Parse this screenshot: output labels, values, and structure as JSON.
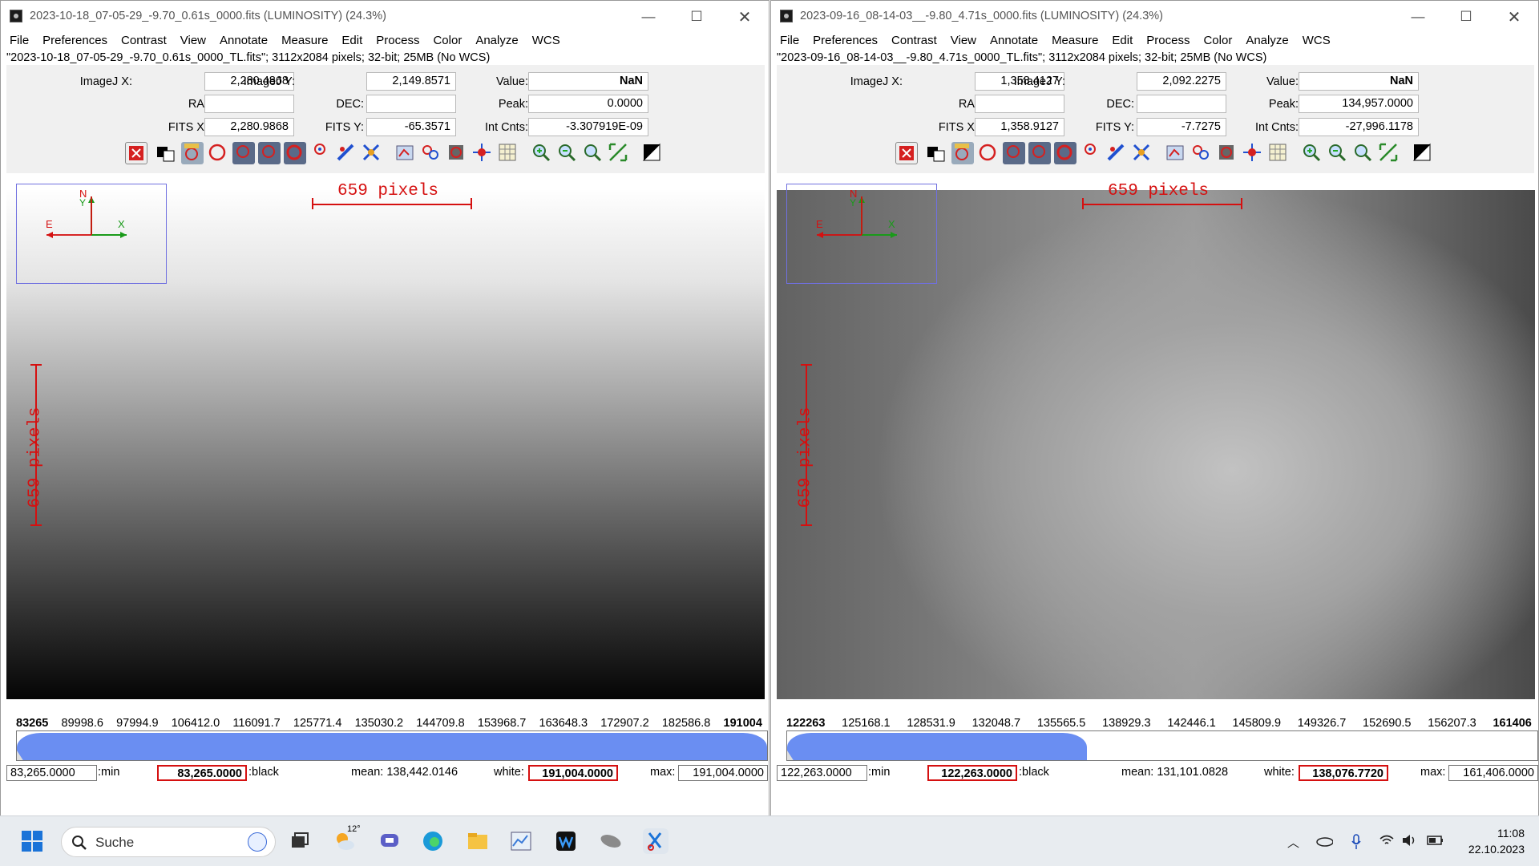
{
  "windows": [
    {
      "title": "2023-10-18_07-05-29_-9.70_0.61s_0000.fits (LUMINOSITY) (24.3%)",
      "menu": [
        "File",
        "Preferences",
        "Contrast",
        "View",
        "Annotate",
        "Measure",
        "Edit",
        "Process",
        "Color",
        "Analyze",
        "WCS"
      ],
      "info": "\"2023-10-18_07-05-29_-9.70_0.61s_0000_TL.fits\"; 3112x2084 pixels; 32-bit; 25MB (No WCS)",
      "labels": {
        "imagej_x": "ImageJ X:",
        "imagej_y": "ImageJ Y:",
        "value": "Value:",
        "ra": "RA:",
        "dec": "DEC:",
        "peak": "Peak:",
        "fits_x": "FITS X:",
        "fits_y": "FITS Y:",
        "int_cnts": "Int Cnts:"
      },
      "fields": {
        "imagej_x": "2,280.4868",
        "imagej_y": "2,149.8571",
        "value": "NaN",
        "ra": "",
        "dec": "",
        "peak": "0.0000",
        "fits_x": "2,280.9868",
        "fits_y": "-65.3571",
        "int_cnts": "-3.307919E-09"
      },
      "scale_text": "659 pixels",
      "compass": {
        "n": "N",
        "y": "Y",
        "e": "E",
        "x": "X"
      },
      "hist_ticks": [
        "83265",
        "89998.6",
        "97994.9",
        "106412.0",
        "116091.7",
        "125771.4",
        "135030.2",
        "144709.8",
        "153968.7",
        "163648.3",
        "172907.2",
        "182586.8",
        "191004"
      ],
      "hist_fill_fraction": 1.0,
      "bottom": {
        "min": "83,265.0000",
        "min_label": ":min",
        "black": "83,265.0000",
        "black_label": ":black",
        "mean": "mean: 138,442.0146",
        "white_label": "white:",
        "white": "191,004.0000",
        "max_label": "max:",
        "max": "191,004.0000"
      }
    },
    {
      "title": "2023-09-16_08-14-03__-9.80_4.71s_0000.fits (LUMINOSITY) (24.3%)",
      "menu": [
        "File",
        "Preferences",
        "Contrast",
        "View",
        "Annotate",
        "Measure",
        "Edit",
        "Process",
        "Color",
        "Analyze",
        "WCS"
      ],
      "info": "\"2023-09-16_08-14-03__-9.80_4.71s_0000_TL.fits\"; 3112x2084 pixels; 32-bit; 25MB (No WCS)",
      "labels": {
        "imagej_x": "ImageJ X:",
        "imagej_y": "ImageJ Y:",
        "value": "Value:",
        "ra": "RA:",
        "dec": "DEC:",
        "peak": "Peak:",
        "fits_x": "FITS X:",
        "fits_y": "FITS Y:",
        "int_cnts": "Int Cnts:"
      },
      "fields": {
        "imagej_x": "1,358.4127",
        "imagej_y": "2,092.2275",
        "value": "NaN",
        "ra": "",
        "dec": "",
        "peak": "134,957.0000",
        "fits_x": "1,358.9127",
        "fits_y": "-7.7275",
        "int_cnts": "-27,996.1178"
      },
      "scale_text": "659 pixels",
      "compass": {
        "n": "N",
        "y": "Y",
        "e": "E",
        "x": "X"
      },
      "hist_ticks": [
        "122263",
        "125168.1",
        "128531.9",
        "132048.7",
        "135565.5",
        "138929.3",
        "142446.1",
        "145809.9",
        "149326.7",
        "152690.5",
        "156207.3",
        "161406"
      ],
      "hist_fill_fraction": 0.4,
      "bottom": {
        "min": "122,263.0000",
        "min_label": ":min",
        "black": "122,263.0000",
        "black_label": ":black",
        "mean": "mean: 131,101.0828",
        "white_label": "white:",
        "white": "138,076.7720",
        "max_label": "max:",
        "max": "161,406.0000"
      }
    }
  ],
  "window_controls": {
    "minimize": "—",
    "maximize": "☐",
    "close": "✕"
  },
  "taskbar": {
    "search_placeholder": "Suche",
    "weather": "12°",
    "time": "11:08",
    "date": "22.10.2023"
  },
  "colors": {
    "histogram_fill": "#6a8ef2",
    "red_annotation": "#d51010",
    "nav_box": "#7070e0"
  }
}
